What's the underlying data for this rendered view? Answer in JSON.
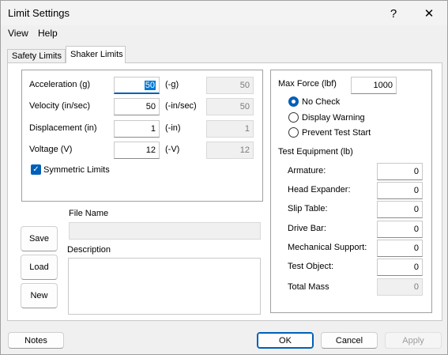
{
  "window": {
    "title": "Limit Settings",
    "help_glyph": "?",
    "close_glyph": "✕"
  },
  "menu": {
    "view": "View",
    "help": "Help"
  },
  "tabs": {
    "safety": "Safety Limits",
    "shaker": "Shaker Limits"
  },
  "limits": {
    "acceleration": {
      "label": "Acceleration (g)",
      "value": "50",
      "neg_label": "(-g)",
      "neg_value": "50"
    },
    "velocity": {
      "label": "Velocity (in/sec)",
      "value": "50",
      "neg_label": "(-in/sec)",
      "neg_value": "50"
    },
    "displacement": {
      "label": "Displacement (in)",
      "value": "1",
      "neg_label": "(-in)",
      "neg_value": "1"
    },
    "voltage": {
      "label": "Voltage (V)",
      "value": "12",
      "neg_label": "(-V)",
      "neg_value": "12"
    },
    "symmetric": {
      "label": "Symmetric Limits",
      "checked": true
    }
  },
  "file": {
    "name_label": "File Name",
    "name_value": "",
    "description_label": "Description",
    "description_value": ""
  },
  "file_buttons": {
    "save": "Save",
    "load": "Load",
    "new": "New"
  },
  "force": {
    "label": "Max Force",
    "unit": "(lbf)",
    "value": "1000",
    "options": [
      "No Check",
      "Display Warning",
      "Prevent Test Start"
    ],
    "selected": "No Check"
  },
  "equipment": {
    "title": "Test Equipment (lb)",
    "armature": {
      "label": "Armature:",
      "value": "0"
    },
    "head_expander": {
      "label": "Head Expander:",
      "value": "0"
    },
    "slip_table": {
      "label": "Slip Table:",
      "value": "0"
    },
    "drive_bar": {
      "label": "Drive Bar:",
      "value": "0"
    },
    "mechanical_support": {
      "label": "Mechanical Support:",
      "value": "0"
    },
    "test_object": {
      "label": "Test Object:",
      "value": "0"
    },
    "total_mass": {
      "label": "Total Mass",
      "value": "0"
    }
  },
  "bottom": {
    "notes": "Notes",
    "ok": "OK",
    "cancel": "Cancel",
    "apply": "Apply"
  },
  "colors": {
    "accent": "#005fb8",
    "selection": "#0078d7"
  }
}
